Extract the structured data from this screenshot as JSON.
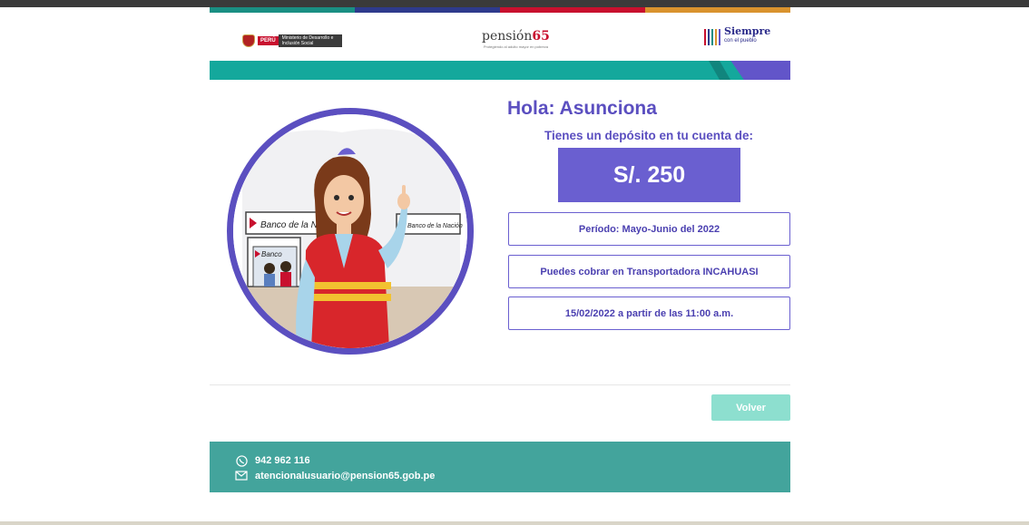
{
  "header": {
    "stripe_colors": [
      "#1a8f83",
      "#2e3a8c",
      "#c8102e",
      "#d9932e"
    ],
    "ministerio_logo": {
      "country": "PERÚ",
      "text": "Ministerio de Desarrollo e Inclusión Social"
    },
    "pension_logo": {
      "name_prefix": "pensión",
      "name_number": "65",
      "tagline": "Protegiendo al adulto mayor en pobreza"
    },
    "siempre_logo": {
      "line1": "Siempre",
      "line2": "con el pueblo"
    }
  },
  "greeting": "Hola: Asunciona",
  "deposit_label": "Tienes un depósito en tu cuenta de:",
  "amount": "S/. 250",
  "info": [
    "Período: Mayo-Junio del 2022",
    "Puedes cobrar en Transportadora INCAHUASI",
    "15/02/2022 a partir de las 11:00 a.m."
  ],
  "illustration": {
    "sign_left": "Banco de la Nación",
    "sign_right": "Banco de la Nación",
    "sign_door": "Banco"
  },
  "volver_label": "Volver",
  "footer": {
    "phone": "942 962 116",
    "email": "atencionalusuario@pension65.gob.pe"
  },
  "colors": {
    "primary": "#5b4fc0",
    "teal": "#14a89c",
    "footer": "#43a49c",
    "button": "#8ddfcf"
  }
}
